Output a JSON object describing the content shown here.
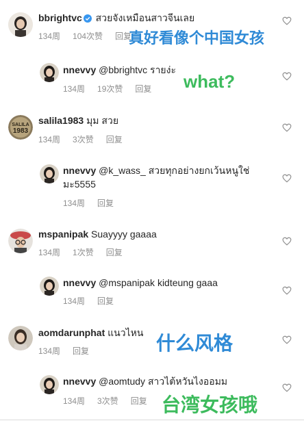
{
  "colors": {
    "annotation_blue": "#2f8ad6",
    "annotation_green": "#3dbb5d",
    "meta_gray": "#8e8e8e",
    "verified_blue": "#3897f0"
  },
  "comments": [
    {
      "user": "bbrightvc",
      "verified": true,
      "text": "สวยจังเหมือนสาวจีนเลย",
      "time": "134周",
      "likes": "104次赞",
      "reply": "回复",
      "annotation": "真好看像个中国女孩"
    },
    {
      "user": "nnevvy",
      "text": "@bbrightvc รายง่ะ",
      "time": "134周",
      "likes": "19次赞",
      "reply": "回复",
      "annotation": "what?"
    },
    {
      "user": "salila1983",
      "text": "มุม สวย",
      "time": "134周",
      "likes": "3次赞",
      "reply": "回复"
    },
    {
      "user": "nnevvy",
      "text": "@k_wass_ สวยทุกอย่างยกเว้นหนูใช่มะ5555",
      "time": "134周",
      "reply": "回复"
    },
    {
      "user": "mspanipak",
      "text": "Suayyyy gaaaa",
      "time": "134周",
      "likes": "1次赞",
      "reply": "回复"
    },
    {
      "user": "nnevvy",
      "text": "@mspanipak kidteung gaaa",
      "time": "134周",
      "reply": "回复"
    },
    {
      "user": "aomdarunphat",
      "text": "แนวไหน",
      "time": "134周",
      "reply": "回复",
      "annotation": "什么风格"
    },
    {
      "user": "nnevvy",
      "text": "@aomtudy สาวไต้หวันไงออมม",
      "time": "134周",
      "likes": "3次赞",
      "reply": "回复",
      "annotation": "台湾女孩哦"
    }
  ],
  "avatar_text": {
    "salila": "SALILA\n1983"
  }
}
